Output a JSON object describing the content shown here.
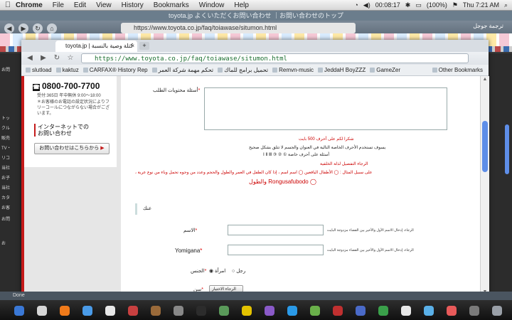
{
  "menubar": {
    "apple": "",
    "app": "Chrome",
    "items": [
      "File",
      "Edit",
      "View",
      "History",
      "Bookmarks",
      "Window",
      "Help"
    ],
    "timer": "00:08:17",
    "battery": "(100%)",
    "clock": "Thu 7:21 AM"
  },
  "back_window": {
    "title": "toyota.jp よくいただくお問い合わせ ｜お問い合わせのトップ",
    "url": "https://www.toyota.co.jp/faq/toiawase/situmon.html",
    "tab_arabic": "ترجمة جوجل",
    "most_visited": "Most"
  },
  "window": {
    "tab_title": "toyota.jp | كتلة وصية بالنسبة",
    "url_host": "https://www.toyota.co.jp",
    "url_path": "/faq/toiawase/situmon.html",
    "bookmarks": [
      "slutload",
      "kaktuz",
      "CARFAX® History Rep",
      "تحكم مهمة شركة العمر",
      "تحميل برامج للماك",
      "Remvn-music",
      "JeddaH BoyZZZ",
      "GameZer"
    ],
    "other_bookmarks": "Other Bookmarks",
    "status": "Done"
  },
  "sidebar": {
    "tel": "0800-700-7700",
    "hours": "受付:365日 年中無休 9:00～18:00",
    "note": "＊お客様のお電話の設定状況によりフリーコールにつながらない場合がございます。",
    "inet_line1": "インターネットでの",
    "inet_line2": "お問い合わせ",
    "cta": "お問い合わせはこちらから"
  },
  "left_strip": [
    "お問",
    "トッ",
    "クル",
    "販売",
    "TV・",
    "リコ",
    "当社",
    "お子",
    "当社",
    "カタ",
    "お客",
    "お問",
    "お"
  ],
  "form": {
    "content_label": "أسئلة محتويات الطلب",
    "limit": "شكرا لكم على أحرف 500 بايت",
    "hint1": "يسوف تستخدم الأحرف الخاصة التالية في العنوان والجسم لا تتلق بشكل صحيح",
    "hint2": "أسئلة على أحرف خاصة ① ② ③ Ⅰ Ⅱ Ⅲ",
    "hint3": "الرجاء التفصيل لذلة الخلفية",
    "hint4": "على سبيل المثال : ◯ الأطفال اليافعين ◯ اسم اسم ، إذا كان الطفل في العمر والطول والحجم وعدد من وجوه تحمل وباء من نوع عربة ،",
    "hint5": "◯ Rongusafubodo والطول",
    "section": "عنك",
    "name_label": "الاسم",
    "name_note": "الرجاء، إدخال الاسم الأول والأخير بين الفضاء مزدوجة البايت",
    "yomi_label": "Yomigana",
    "yomi_note": "الرجاء، إدخال الاسم الأول والأخير بين الفضاء مزدوجة البايت",
    "gender_label": "الجنس",
    "gender_male": "رجل",
    "gender_female": "امرأة",
    "age_label": "سن",
    "age_select": "الرجاء الاختيار"
  }
}
